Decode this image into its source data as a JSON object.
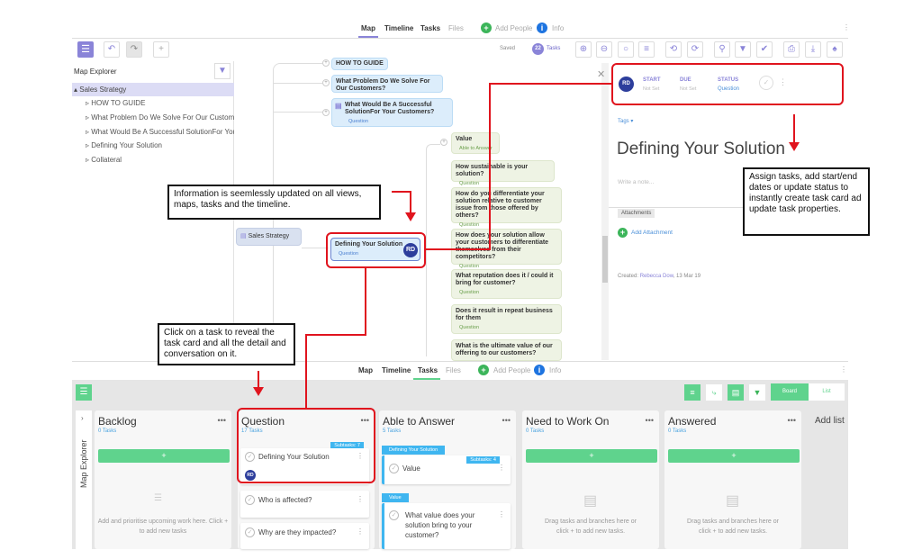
{
  "top_app": {
    "nav": {
      "map": "Map",
      "timeline": "Timeline",
      "tasks": "Tasks",
      "files": "Files",
      "add_people": "Add People",
      "info": "Info"
    },
    "toolbar": {
      "saved": "Saved",
      "task_count": "22",
      "tasks_label": "Tasks"
    },
    "sidebar": {
      "title": "Map Explorer",
      "root": "Sales Strategy",
      "items": [
        "HOW TO GUIDE",
        "What Problem Do We Solve For Our Customers?",
        "What Would Be A Successful SolutionFor Your Customers?",
        "Defining Your Solution",
        "Collateral"
      ]
    },
    "map": {
      "nodes_top": [
        {
          "text": "HOW TO GUIDE"
        },
        {
          "text": "What Problem Do We Solve For Our Customers?"
        },
        {
          "text": "What Would Be A Successful SolutionFor Your Customers?",
          "tag": "Question"
        }
      ],
      "root": "Sales Strategy",
      "selected": {
        "text": "Defining Your Solution",
        "tag": "Question",
        "avatar": "RD"
      },
      "children": [
        {
          "text": "Value",
          "tag": "Able to Answer"
        },
        {
          "text": "How sustainable is your solution?",
          "tag": "Question"
        },
        {
          "text": "How do you differentiate your solution relative to customer issue from those offered by others?",
          "tag": "Question"
        },
        {
          "text": "How does your solution allow your customers to differentiate themselves from their competitors?",
          "tag": "Question"
        },
        {
          "text": "What reputation does it / could it bring for customer?",
          "tag": "Question"
        },
        {
          "text": "Does it result in repeat business for them",
          "tag": "Question"
        },
        {
          "text": "What is the ultimate value of our offering to our customers?",
          "tag": "Question"
        }
      ]
    },
    "task_panel": {
      "avatar": "RD",
      "start_label": "START",
      "start_value": "Not Set",
      "due_label": "DUE",
      "due_value": "Not Set",
      "status_label": "STATUS",
      "status_value": "Question",
      "tags": "Tags ▾",
      "title": "Defining Your Solution",
      "note_placeholder": "Write a note...",
      "attachments": "Attachments",
      "add_attachment": "Add Attachment",
      "created_label": "Created:",
      "created_by": "Rebecca Dow",
      "created_date": ", 13 Mar 19"
    }
  },
  "bottom_app": {
    "nav": {
      "map": "Map",
      "timeline": "Timeline",
      "tasks": "Tasks",
      "files": "Files",
      "add_people": "Add People",
      "info": "Info"
    },
    "view_toggle": {
      "board": "Board",
      "list": "List"
    },
    "sidebar_label": "Map Explorer",
    "columns": [
      {
        "title": "Backlog",
        "count": "0 Tasks",
        "empty": "Add and prioritise upcoming work here. Click + to add new tasks"
      },
      {
        "title": "Question",
        "count": "17 Tasks",
        "cards": [
          {
            "text": "Defining Your Solution",
            "subtasks": "Subtasks: 7",
            "avatar": "RD"
          },
          {
            "text": "Who is affected?"
          },
          {
            "text": "Why are they impacted?"
          }
        ]
      },
      {
        "title": "Able to Answer",
        "count": "5 Tasks",
        "cards": [
          {
            "parent": "Defining Your Solution",
            "text": "Value",
            "subtasks": "Subtasks: 4"
          },
          {
            "parent": "Value",
            "text": "What value does your solution bring to your customer?"
          }
        ]
      },
      {
        "title": "Need to Work On",
        "count": "0 Tasks",
        "empty": "Drag tasks and branches here or click + to add new tasks."
      },
      {
        "title": "Answered",
        "count": "0 Tasks",
        "empty": "Drag tasks and branches here or click + to add new tasks."
      }
    ],
    "add_list": "Add list"
  },
  "annotations": {
    "info": "Information is seemlessly updated on all views, maps, tasks and the timeline.",
    "assign": "Assign tasks, add start/end dates or update status to instantly create task card ad update task properties.",
    "click": "Click on a task to reveal the task card and all the detail and conversation on it."
  },
  "colors": {
    "accent_purple": "#8a84d8",
    "green": "#5fd38d",
    "annotation_red": "#e0141e",
    "link_blue": "#4aa3df"
  }
}
